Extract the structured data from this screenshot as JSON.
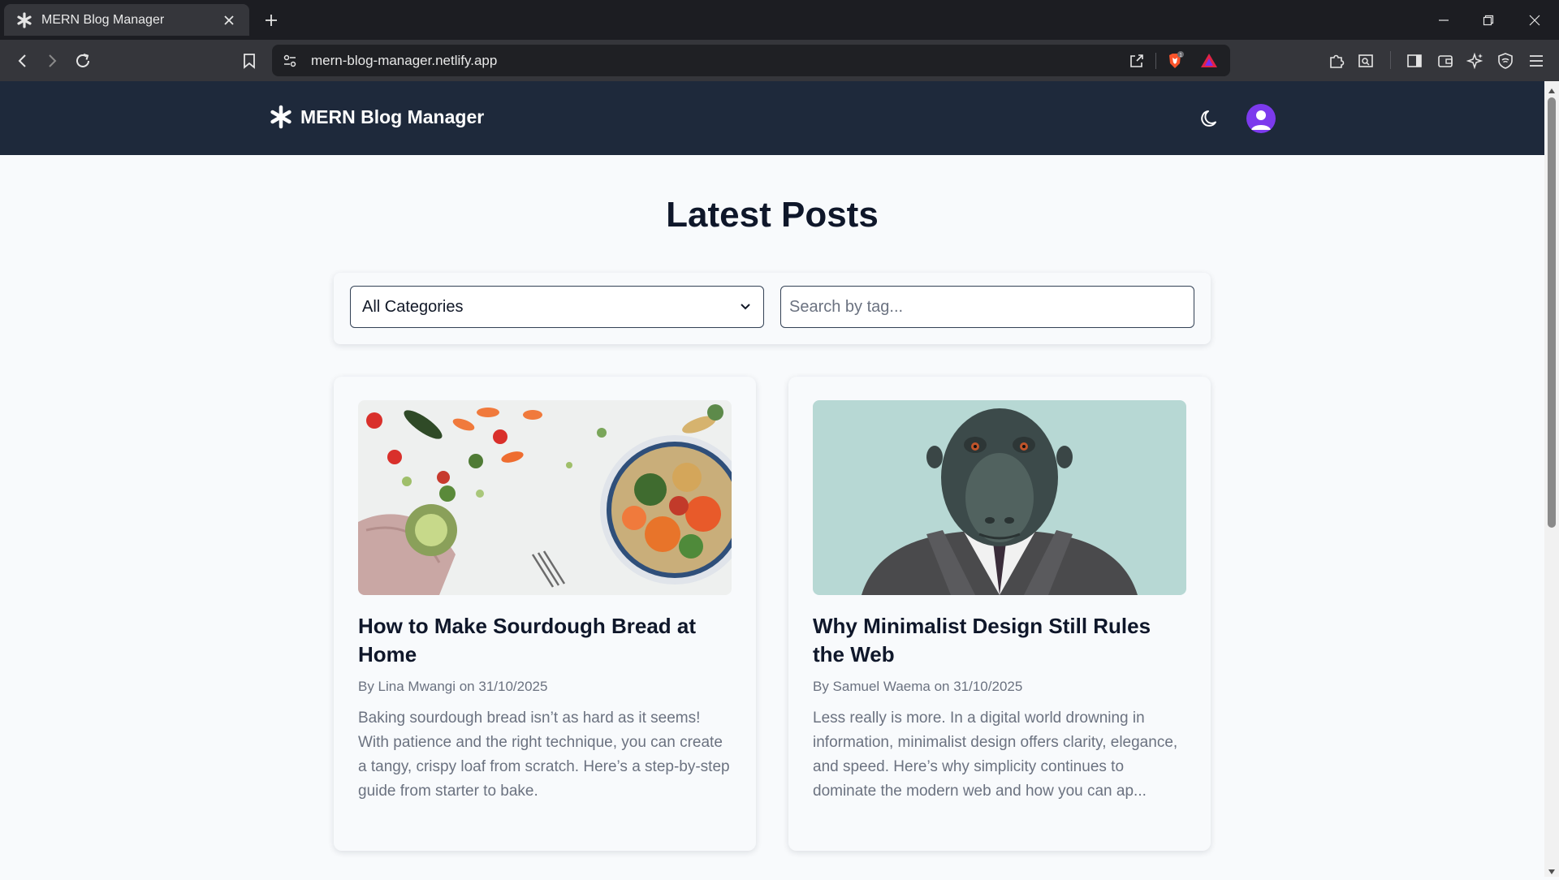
{
  "browser": {
    "tab_title": "MERN Blog Manager",
    "url": "mern-blog-manager.netlify.app",
    "shield_badge": "1"
  },
  "site": {
    "brand": "MERN Blog Manager",
    "accent_color": "#1e293b",
    "avatar_color": "#7c3aed"
  },
  "page": {
    "title": "Latest Posts"
  },
  "filters": {
    "category_selected": "All Categories",
    "tag_placeholder": "Search by tag..."
  },
  "posts": [
    {
      "title": "How to Make Sourdough Bread at Home",
      "meta": "By Lina Mwangi on 31/10/2025",
      "excerpt": "Baking sourdough bread isn’t as hard as it seems! With patience and the right technique, you can create a tangy, crispy loaf from scratch. Here’s a step-by-step guide from starter to bake.",
      "image": "food-bowl-vegetables"
    },
    {
      "title": "Why Minimalist Design Still Rules the Web",
      "meta": "By Samuel Waema on 31/10/2025",
      "excerpt": "Less really is more. In a digital world drowning in information, minimalist design offers clarity, elegance, and speed. Here’s why simplicity continues to dominate the modern web and how you can ap...",
      "image": "monkey-in-suit"
    }
  ]
}
